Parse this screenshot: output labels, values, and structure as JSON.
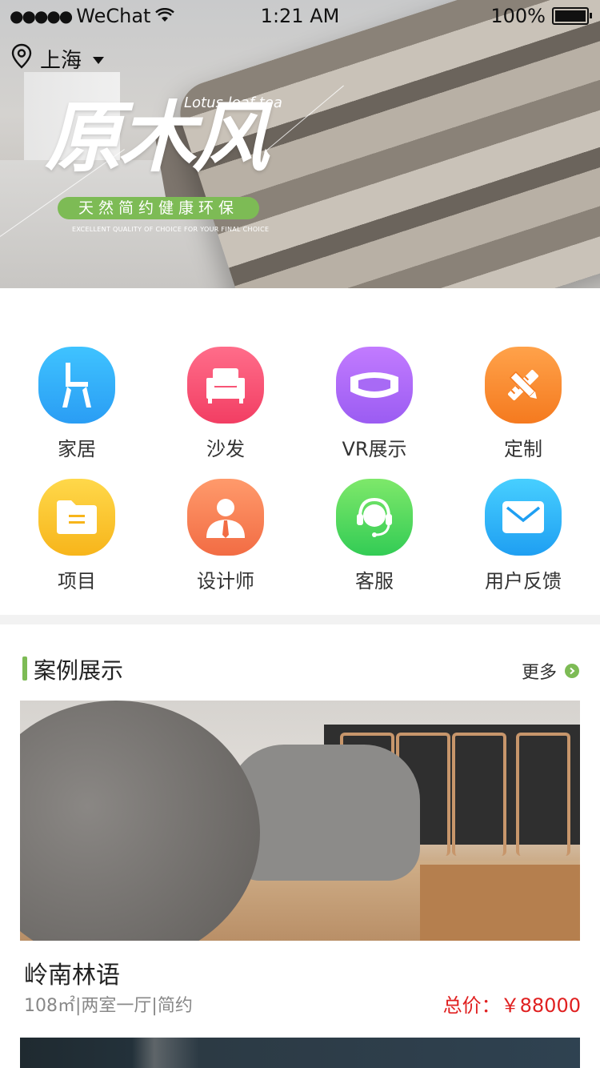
{
  "status_bar": {
    "signal_dots": "●●●●●",
    "carrier": "WeChat",
    "time": "1:21 AM",
    "battery": "100%"
  },
  "location": {
    "city": "上海"
  },
  "banner": {
    "title": "原木风",
    "title_en": "Lotus leaf  tea",
    "slogan": "天然简约健康环保",
    "slogan_en": "EXCELLENT QUALITY OF CHOICE FOR YOUR FINAL CHOICE"
  },
  "grid": {
    "items": [
      {
        "label": "家居",
        "icon": "chair-icon",
        "color_from": "#3fc3ff",
        "color_to": "#2a9df4"
      },
      {
        "label": "沙发",
        "icon": "sofa-icon",
        "color_from": "#ff6d8a",
        "color_to": "#f23e63"
      },
      {
        "label": "VR展示",
        "icon": "vr-headset-icon",
        "color_from": "#c27bff",
        "color_to": "#9b5cf2"
      },
      {
        "label": "定制",
        "icon": "ruler-pencil-icon",
        "color_from": "#ffa24a",
        "color_to": "#f57a1f"
      },
      {
        "label": "项目",
        "icon": "folder-icon",
        "color_from": "#ffd84a",
        "color_to": "#f7b51b"
      },
      {
        "label": "设计师",
        "icon": "designer-icon",
        "color_from": "#ff9a6b",
        "color_to": "#f26c44"
      },
      {
        "label": "客服",
        "icon": "headset-icon",
        "color_from": "#7ee86a",
        "color_to": "#33cc55"
      },
      {
        "label": "用户反馈",
        "icon": "mail-icon",
        "color_from": "#47cfff",
        "color_to": "#1f9ff2"
      }
    ]
  },
  "cases": {
    "section_title": "案例展示",
    "more_label": "更多",
    "items": [
      {
        "name": "岭南林语",
        "meta": "108㎡|两室一厅|简约",
        "price": "总价：￥88000"
      }
    ]
  },
  "colors": {
    "accent": "#7dbb55",
    "price": "#e02020"
  }
}
